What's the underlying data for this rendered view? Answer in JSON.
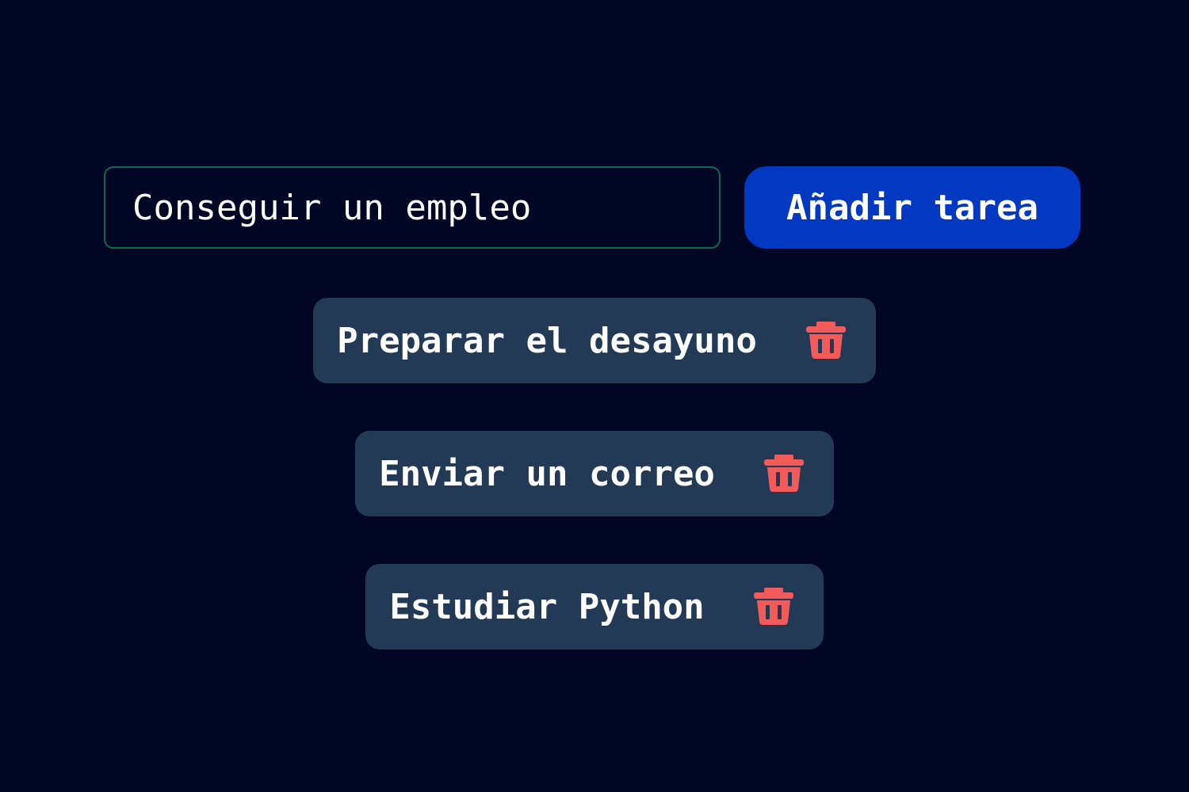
{
  "form": {
    "input_value": "Conseguir un empleo",
    "add_button_label": "Añadir tarea"
  },
  "tasks": [
    {
      "label": "Preparar el desayuno",
      "delete_icon": "trash-icon"
    },
    {
      "label": "Enviar un correo",
      "delete_icon": "trash-icon"
    },
    {
      "label": "Estudiar Python",
      "delete_icon": "trash-icon"
    }
  ],
  "colors": {
    "background": "#000624",
    "input_border": "#0f6b4f",
    "button_primary": "#0339c2",
    "task_card": "#223a55",
    "delete_icon": "#f35a5a",
    "text": "#ffffff"
  }
}
